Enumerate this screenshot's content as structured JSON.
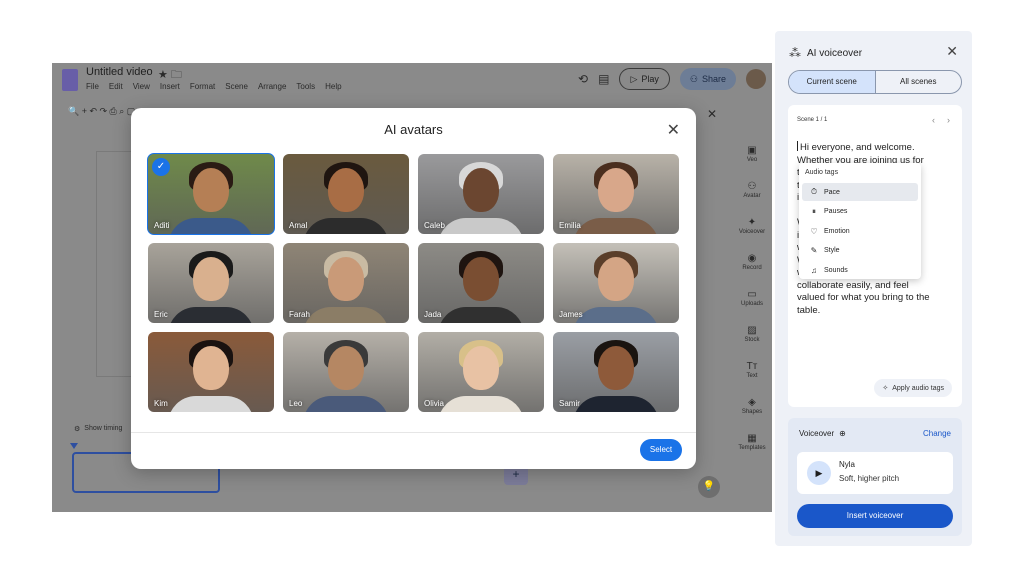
{
  "app": {
    "doc_title": "Untitled video",
    "title_icons": "★ 🗀",
    "menu": [
      "File",
      "Edit",
      "View",
      "Insert",
      "Format",
      "Scene",
      "Arrange",
      "Tools",
      "Help"
    ],
    "play_label": "Play",
    "share_label": "Share",
    "toolbar_icons": "🔍 + ↶ ↷ ⎙ ⌕  ▢ ▤ ◇ ◉",
    "show_timing_label": "Show timing",
    "add_scene": "+"
  },
  "side_rail": [
    {
      "icon": "▣",
      "label": "Veo"
    },
    {
      "icon": "⚇",
      "label": "Avatar"
    },
    {
      "icon": "✦",
      "label": "Voiceover"
    },
    {
      "icon": "◉",
      "label": "Record"
    },
    {
      "icon": "▭",
      "label": "Uploads"
    },
    {
      "icon": "▨",
      "label": "Stock"
    },
    {
      "icon": "Tт",
      "label": "Text"
    },
    {
      "icon": "◈",
      "label": "Shapes"
    },
    {
      "icon": "▦",
      "label": "Templates"
    }
  ],
  "modal": {
    "title": "AI avatars",
    "select_label": "Select",
    "avatars": [
      {
        "name": "Aditi",
        "bg": "#6f8a4a",
        "skin": "#b57f55",
        "hair": "#2a1b14",
        "shirt": "#3b5a8a",
        "selected": true
      },
      {
        "name": "Amal",
        "bg": "#6a5a3e",
        "skin": "#a86d45",
        "hair": "#1f1510",
        "shirt": "#2c2c2c",
        "selected": false
      },
      {
        "name": "Caleb",
        "bg": "#9a9a9c",
        "skin": "#6b4630",
        "hair": "#d8d8d8",
        "shirt": "#c9c9c9",
        "selected": false
      },
      {
        "name": "Emilia",
        "bg": "#b8b2a8",
        "skin": "#d8a78a",
        "hair": "#4a2e1e",
        "shirt": "#7a5d48",
        "selected": false
      },
      {
        "name": "Eric",
        "bg": "#a8a39a",
        "skin": "#d9b08e",
        "hair": "#1a1a1a",
        "shirt": "#2a2d33",
        "selected": false
      },
      {
        "name": "Farah",
        "bg": "#8f8576",
        "skin": "#c99a78",
        "hair": "#c9bba3",
        "shirt": "#8b7d66",
        "selected": false
      },
      {
        "name": "Jada",
        "bg": "#8d8b86",
        "skin": "#7a4e32",
        "hair": "#1e1410",
        "shirt": "#303030",
        "selected": false
      },
      {
        "name": "James",
        "bg": "#c4c0b8",
        "skin": "#d4a585",
        "hair": "#5a3e2a",
        "shirt": "#5b6e8a",
        "selected": false
      },
      {
        "name": "Kim",
        "bg": "#8a5a3a",
        "skin": "#e0b492",
        "hair": "#1a1210",
        "shirt": "#d9d9d9",
        "selected": false
      },
      {
        "name": "Leo",
        "bg": "#b5b0a8",
        "skin": "#b58763",
        "hair": "#3a3a3a",
        "shirt": "#4a5a7a",
        "selected": false
      },
      {
        "name": "Olivia",
        "bg": "#b2aea6",
        "skin": "#e8c2a4",
        "hair": "#d8c089",
        "shirt": "#e6e0d6",
        "selected": false
      },
      {
        "name": "Samir",
        "bg": "#9a9ea4",
        "skin": "#8e5a3a",
        "hair": "#1a1410",
        "shirt": "#1e2430",
        "selected": false
      }
    ]
  },
  "voiceover": {
    "title": "AI voiceover",
    "tabs": [
      "Current scene",
      "All scenes"
    ],
    "scene_label": "Scene 1 / 1",
    "script_lines": [
      "Hi everyone, and welcome.",
      "Whether you are joining us for",
      "the first time or joining our",
      "team from elsewhere, you're",
      "in the right place.",
      "",
      "We're so excited to",
      "introduce you to the way of",
      "working that we share.",
      "We believe in an atmosphere",
      "where everyone can",
      "collaborate easily, and feel",
      "valued for what you bring to the",
      "table."
    ],
    "audio_tags_title": "Audio tags",
    "audio_tags": [
      {
        "icon": "⏱",
        "label": "Pace",
        "highlighted": true
      },
      {
        "icon": "⏸",
        "label": "Pauses",
        "highlighted": false
      },
      {
        "icon": "♡",
        "label": "Emotion",
        "highlighted": false
      },
      {
        "icon": "✎",
        "label": "Style",
        "highlighted": false
      },
      {
        "icon": "♫",
        "label": "Sounds",
        "highlighted": false
      }
    ],
    "apply_label": "Apply audio tags",
    "voiceover_label": "Voiceover",
    "change_label": "Change",
    "voice_name": "Nyla",
    "voice_desc": "Soft, higher pitch",
    "insert_label": "Insert voiceover"
  }
}
